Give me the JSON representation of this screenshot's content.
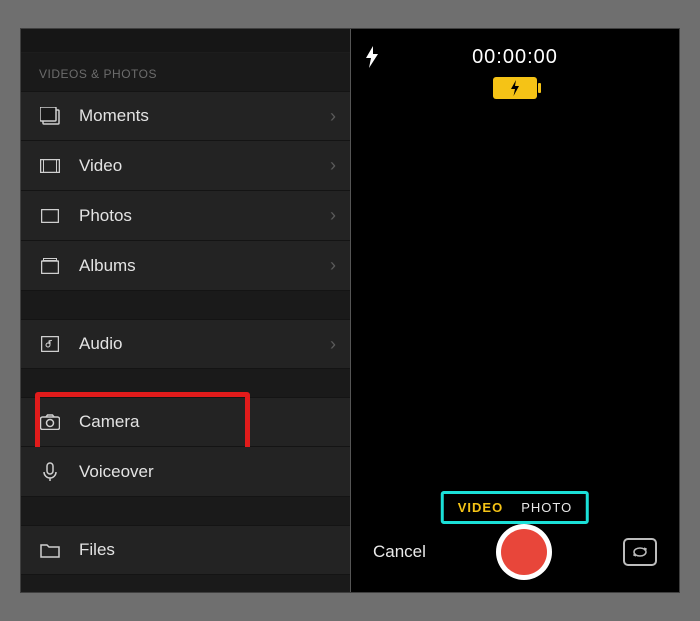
{
  "sidebar": {
    "section_label": "VIDEOS & PHOTOS",
    "items_group1": [
      {
        "label": "Moments",
        "icon": "moments-icon"
      },
      {
        "label": "Video",
        "icon": "video-icon"
      },
      {
        "label": "Photos",
        "icon": "photos-icon"
      },
      {
        "label": "Albums",
        "icon": "albums-icon"
      }
    ],
    "items_group2": [
      {
        "label": "Audio",
        "icon": "audio-icon"
      }
    ],
    "items_group3": [
      {
        "label": "Camera",
        "icon": "camera-icon",
        "highlight": "red"
      },
      {
        "label": "Voiceover",
        "icon": "mic-icon"
      }
    ],
    "items_group4": [
      {
        "label": "Files",
        "icon": "folder-icon"
      }
    ]
  },
  "camera": {
    "timer": "00:00:00",
    "modes": {
      "video": "VIDEO",
      "photo": "PHOTO",
      "active": "video"
    },
    "cancel_label": "Cancel"
  }
}
